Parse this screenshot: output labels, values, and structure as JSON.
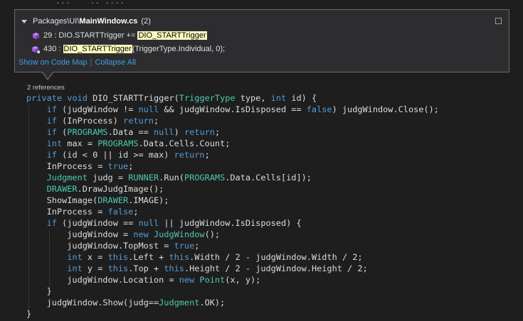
{
  "popup": {
    "file_path": "Packages\\UI\\",
    "file_name": "MainWindow.cs",
    "count": "(2)",
    "refs": [
      {
        "line": "29",
        "before": " : DIO.STARTTrigger += ",
        "highlight": "DIO_STARTTrigger",
        "after": ""
      },
      {
        "line": "430",
        "before": " : ",
        "highlight": "DIO_STARTTrigger",
        "after": "(TriggerType.Individual, 0);"
      }
    ],
    "show_on_code_map": "Show on Code Map",
    "separator": "|",
    "collapse_all": "Collapse All"
  },
  "editor": {
    "background_partial": "...    .. ....",
    "references_label": "2 references",
    "lines": [
      "private void DIO_STARTTrigger(TriggerType type, int id) {",
      "    if (judgWindow != null && judgWindow.IsDisposed == false) judgWindow.Close();",
      "    if (InProcess) return;",
      "    if (PROGRAMS.Data == null) return;",
      "    int max = PROGRAMS.Data.Cells.Count;",
      "    if (id < 0 || id >= max) return;",
      "    InProcess = true;",
      "    Judgment judg = RUNNER.Run(PROGRAMS.Data.Cells[id]);",
      "    DRAWER.DrawJudgImage();",
      "    ShowImage(DRAWER.IMAGE);",
      "    InProcess = false;",
      "    if (judgWindow == null || judgWindow.IsDisposed) {",
      "        judgWindow = new JudgWindow();",
      "        judgWindow.TopMost = true;",
      "        int x = this.Left + this.Width / 2 - judgWindow.Width / 2;",
      "        int y = this.Top + this.Height / 2 - judgWindow.Height / 2;",
      "        judgWindow.Location = new Point(x, y);",
      "    }",
      "    judgWindow.Show(judg==Judgment.OK);",
      "}"
    ]
  },
  "colors": {
    "keyword": "#569cd6",
    "type": "#4ec9b0",
    "text": "#dcdcdc",
    "link": "#3e9fe0",
    "highlight": "#ffffbf"
  }
}
